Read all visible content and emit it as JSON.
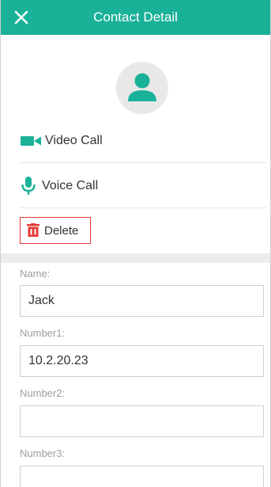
{
  "header": {
    "title": "Contact Detail",
    "close_icon": "close-icon",
    "background": "#1ab199"
  },
  "avatar": {
    "icon": "person-icon",
    "color": "#1ab199"
  },
  "actions": {
    "video_call": {
      "label": "Video Call",
      "icon": "video-camera-icon"
    },
    "voice_call": {
      "label": "Voice Call",
      "icon": "microphone-icon"
    },
    "delete": {
      "label": "Delete",
      "icon": "trash-icon",
      "color": "#e53935"
    }
  },
  "form": {
    "name": {
      "label": "Name:",
      "value": "Jack"
    },
    "number1": {
      "label": "Number1:",
      "value": "10.2.20.23"
    },
    "number2": {
      "label": "Number2:",
      "value": ""
    },
    "number3": {
      "label": "Number3:",
      "value": ""
    }
  }
}
